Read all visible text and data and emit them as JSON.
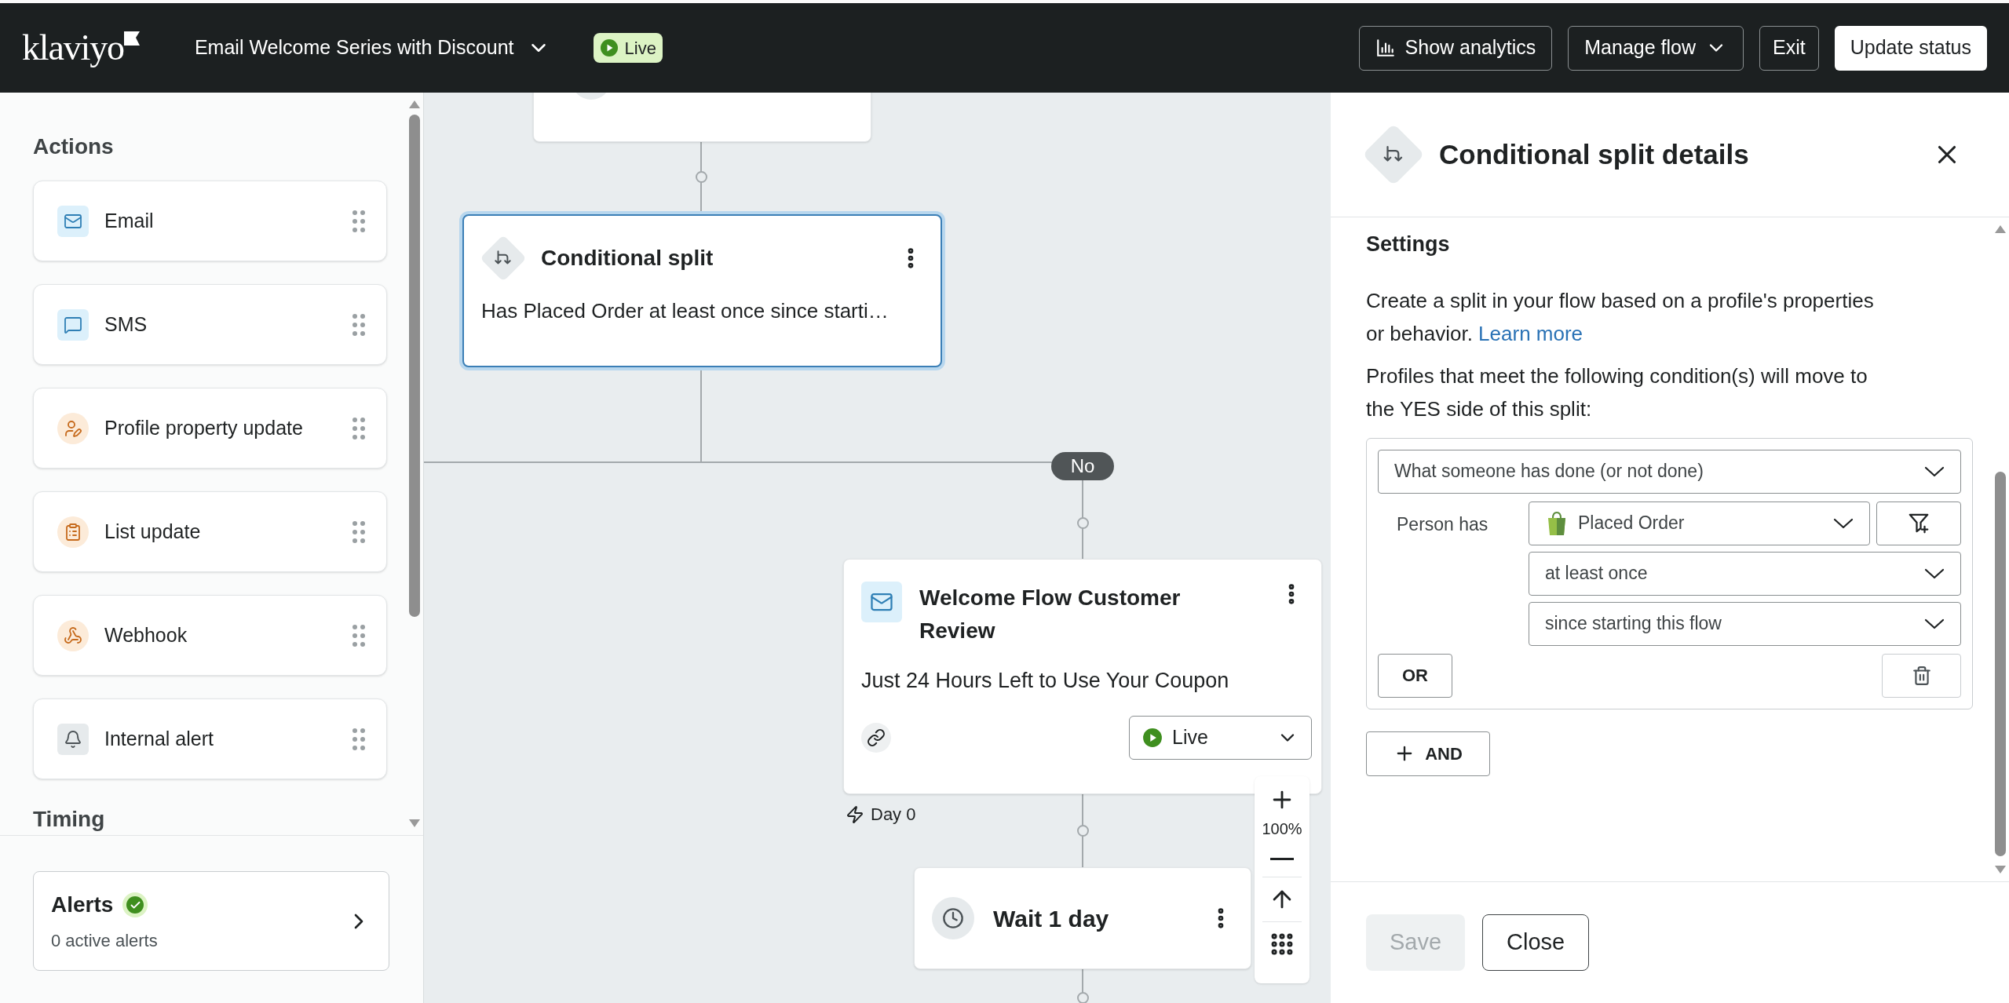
{
  "header": {
    "logo": "klaviyo",
    "flow_name": "Email Welcome Series with Discount",
    "status": "Live",
    "buttons": [
      {
        "label": "Show analytics",
        "kind": "analytics"
      },
      {
        "label": "Manage flow",
        "kind": "menu"
      },
      {
        "label": "Exit",
        "kind": "plain"
      },
      {
        "label": "Update status",
        "kind": "primary"
      }
    ]
  },
  "sidebar": {
    "heading": "Actions",
    "actions": [
      {
        "label": "Email",
        "kind": "email"
      },
      {
        "label": "SMS",
        "kind": "sms"
      },
      {
        "label": "Profile property update",
        "kind": "profile"
      },
      {
        "label": "List update",
        "kind": "list"
      },
      {
        "label": "Webhook",
        "kind": "webhook"
      },
      {
        "label": "Internal alert",
        "kind": "alert"
      }
    ],
    "next_heading": "Timing",
    "alerts": {
      "title": "Alerts",
      "subtitle": "0 active alerts"
    }
  },
  "canvas": {
    "nodes": [
      {
        "kind": "split",
        "title": "Conditional split",
        "description": "Has Placed Order at least once since starti…",
        "selected": true
      },
      {
        "kind": "email",
        "title": "Welcome Flow Customer Review",
        "subject": "Just 24 Hours Left to Use Your Coupon",
        "status": "Live",
        "trigger": "Day 0",
        "selected": false
      },
      {
        "kind": "wait",
        "title": "Wait 1 day"
      }
    ],
    "branch_label": "No",
    "zoom_level": "100%"
  },
  "panel": {
    "title": "Conditional split details",
    "section": "Settings",
    "intro": "Create a split in your flow based on a profile's properties or behavior.",
    "link": "Learn more",
    "condition_intro": "Profiles that meet the following condition(s) will move to the YES side of this split:",
    "condition": {
      "type": "What someone has done (or not done)",
      "subject_label": "Person has",
      "metric": "Placed Order",
      "frequency": "at least once",
      "timeframe": "since starting this flow"
    },
    "or_button": "OR",
    "and_button": "AND",
    "buttons": [
      {
        "label": "Save",
        "disabled": true
      },
      {
        "label": "Close",
        "disabled": false
      }
    ]
  }
}
